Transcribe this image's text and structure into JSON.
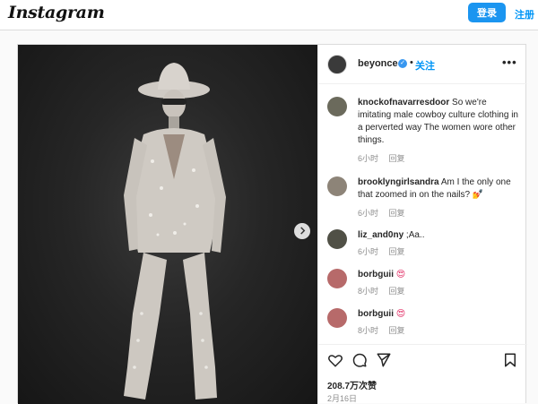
{
  "header": {
    "logo": "Instagram",
    "login_label": "登录",
    "signup_label": "注册"
  },
  "post": {
    "author": "beyonce",
    "separator": "•",
    "follow_label": "关注",
    "more_label": "•••",
    "photo_icon": "photo-of-person-in-cowboy-outfit",
    "comments": [
      {
        "user": "knockofnavarresdoor",
        "text": "So we're imitating male cowboy culture clothing in a perverted way The women wore other things.",
        "time": "6小时",
        "reply": "回复"
      },
      {
        "user": "brooklyngirlsandra",
        "text": "Am I the only one that zoomed in on the nails? 💅",
        "time": "6小时",
        "reply": "回复"
      },
      {
        "user": "liz_and0ny",
        "text": ";Aa..",
        "time": "6小时",
        "reply": "回复"
      },
      {
        "user": "borbguii",
        "text": "😍",
        "time": "8小时",
        "reply": "回复"
      },
      {
        "user": "borbguii",
        "text": "😍",
        "time": "8小时",
        "reply": "回复"
      }
    ],
    "likes": "208.7万次赞",
    "date": "2月16日"
  },
  "colors": {
    "brand_blue": "#0095f6",
    "login_bg": "#1b95f0",
    "verified": "#3897f0",
    "muted": "#8e8e8e"
  },
  "icons": [
    "heart-icon",
    "comment-icon",
    "share-icon",
    "bookmark-icon",
    "chevron-right-icon",
    "verified-icon",
    "more-icon"
  ]
}
